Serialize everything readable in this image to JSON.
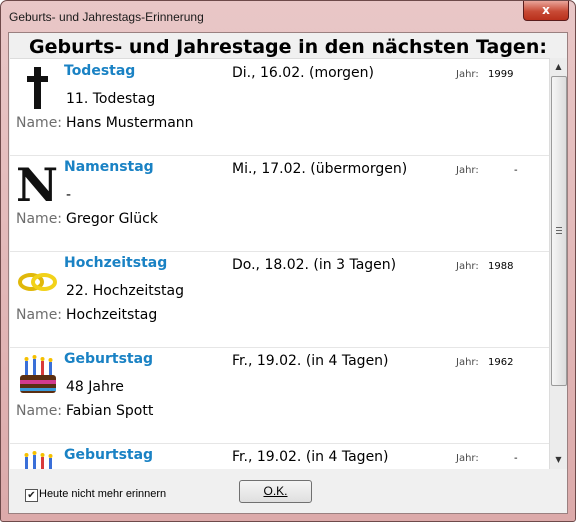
{
  "window": {
    "title": "Geburts- und Jahrestags-Erinnerung",
    "close_glyph": "x"
  },
  "heading": "Geburts- und Jahrestage in den nächsten Tagen:",
  "name_label": "Name:",
  "year_label": "Jahr:",
  "entries": [
    {
      "type": "Todestag",
      "detail": "11. Todestag",
      "name": "Hans Mustermann",
      "date": "Di., 16.02. (morgen)",
      "year": "1999",
      "icon": "cross-icon"
    },
    {
      "type": "Namenstag",
      "detail": "-",
      "name": "Gregor Glück",
      "date": "Mi., 17.02. (übermorgen)",
      "year": "-",
      "icon": "letter-n-icon"
    },
    {
      "type": "Hochzeitstag",
      "detail": "22. Hochzeitstag",
      "name": "Hochzeitstag",
      "date": "Do., 18.02. (in 3 Tagen)",
      "year": "1988",
      "icon": "wedding-rings-icon"
    },
    {
      "type": "Geburtstag",
      "detail": "48 Jahre",
      "name": "Fabian Spott",
      "date": "Fr., 19.02. (in 4 Tagen)",
      "year": "1962",
      "icon": "birthday-cake-icon"
    },
    {
      "type": "Geburtstag",
      "detail": "",
      "name": "",
      "date": "Fr., 19.02. (in 4 Tagen)",
      "year": "-",
      "icon": "birthday-cake-icon"
    }
  ],
  "scrollbar": {
    "up_glyph": "▲",
    "down_glyph": "▼"
  },
  "footer": {
    "checkbox_label": "Heute nicht mehr erinnern",
    "checkbox_checked": true,
    "checkbox_glyph": "✔",
    "ok_label": "O.K."
  }
}
